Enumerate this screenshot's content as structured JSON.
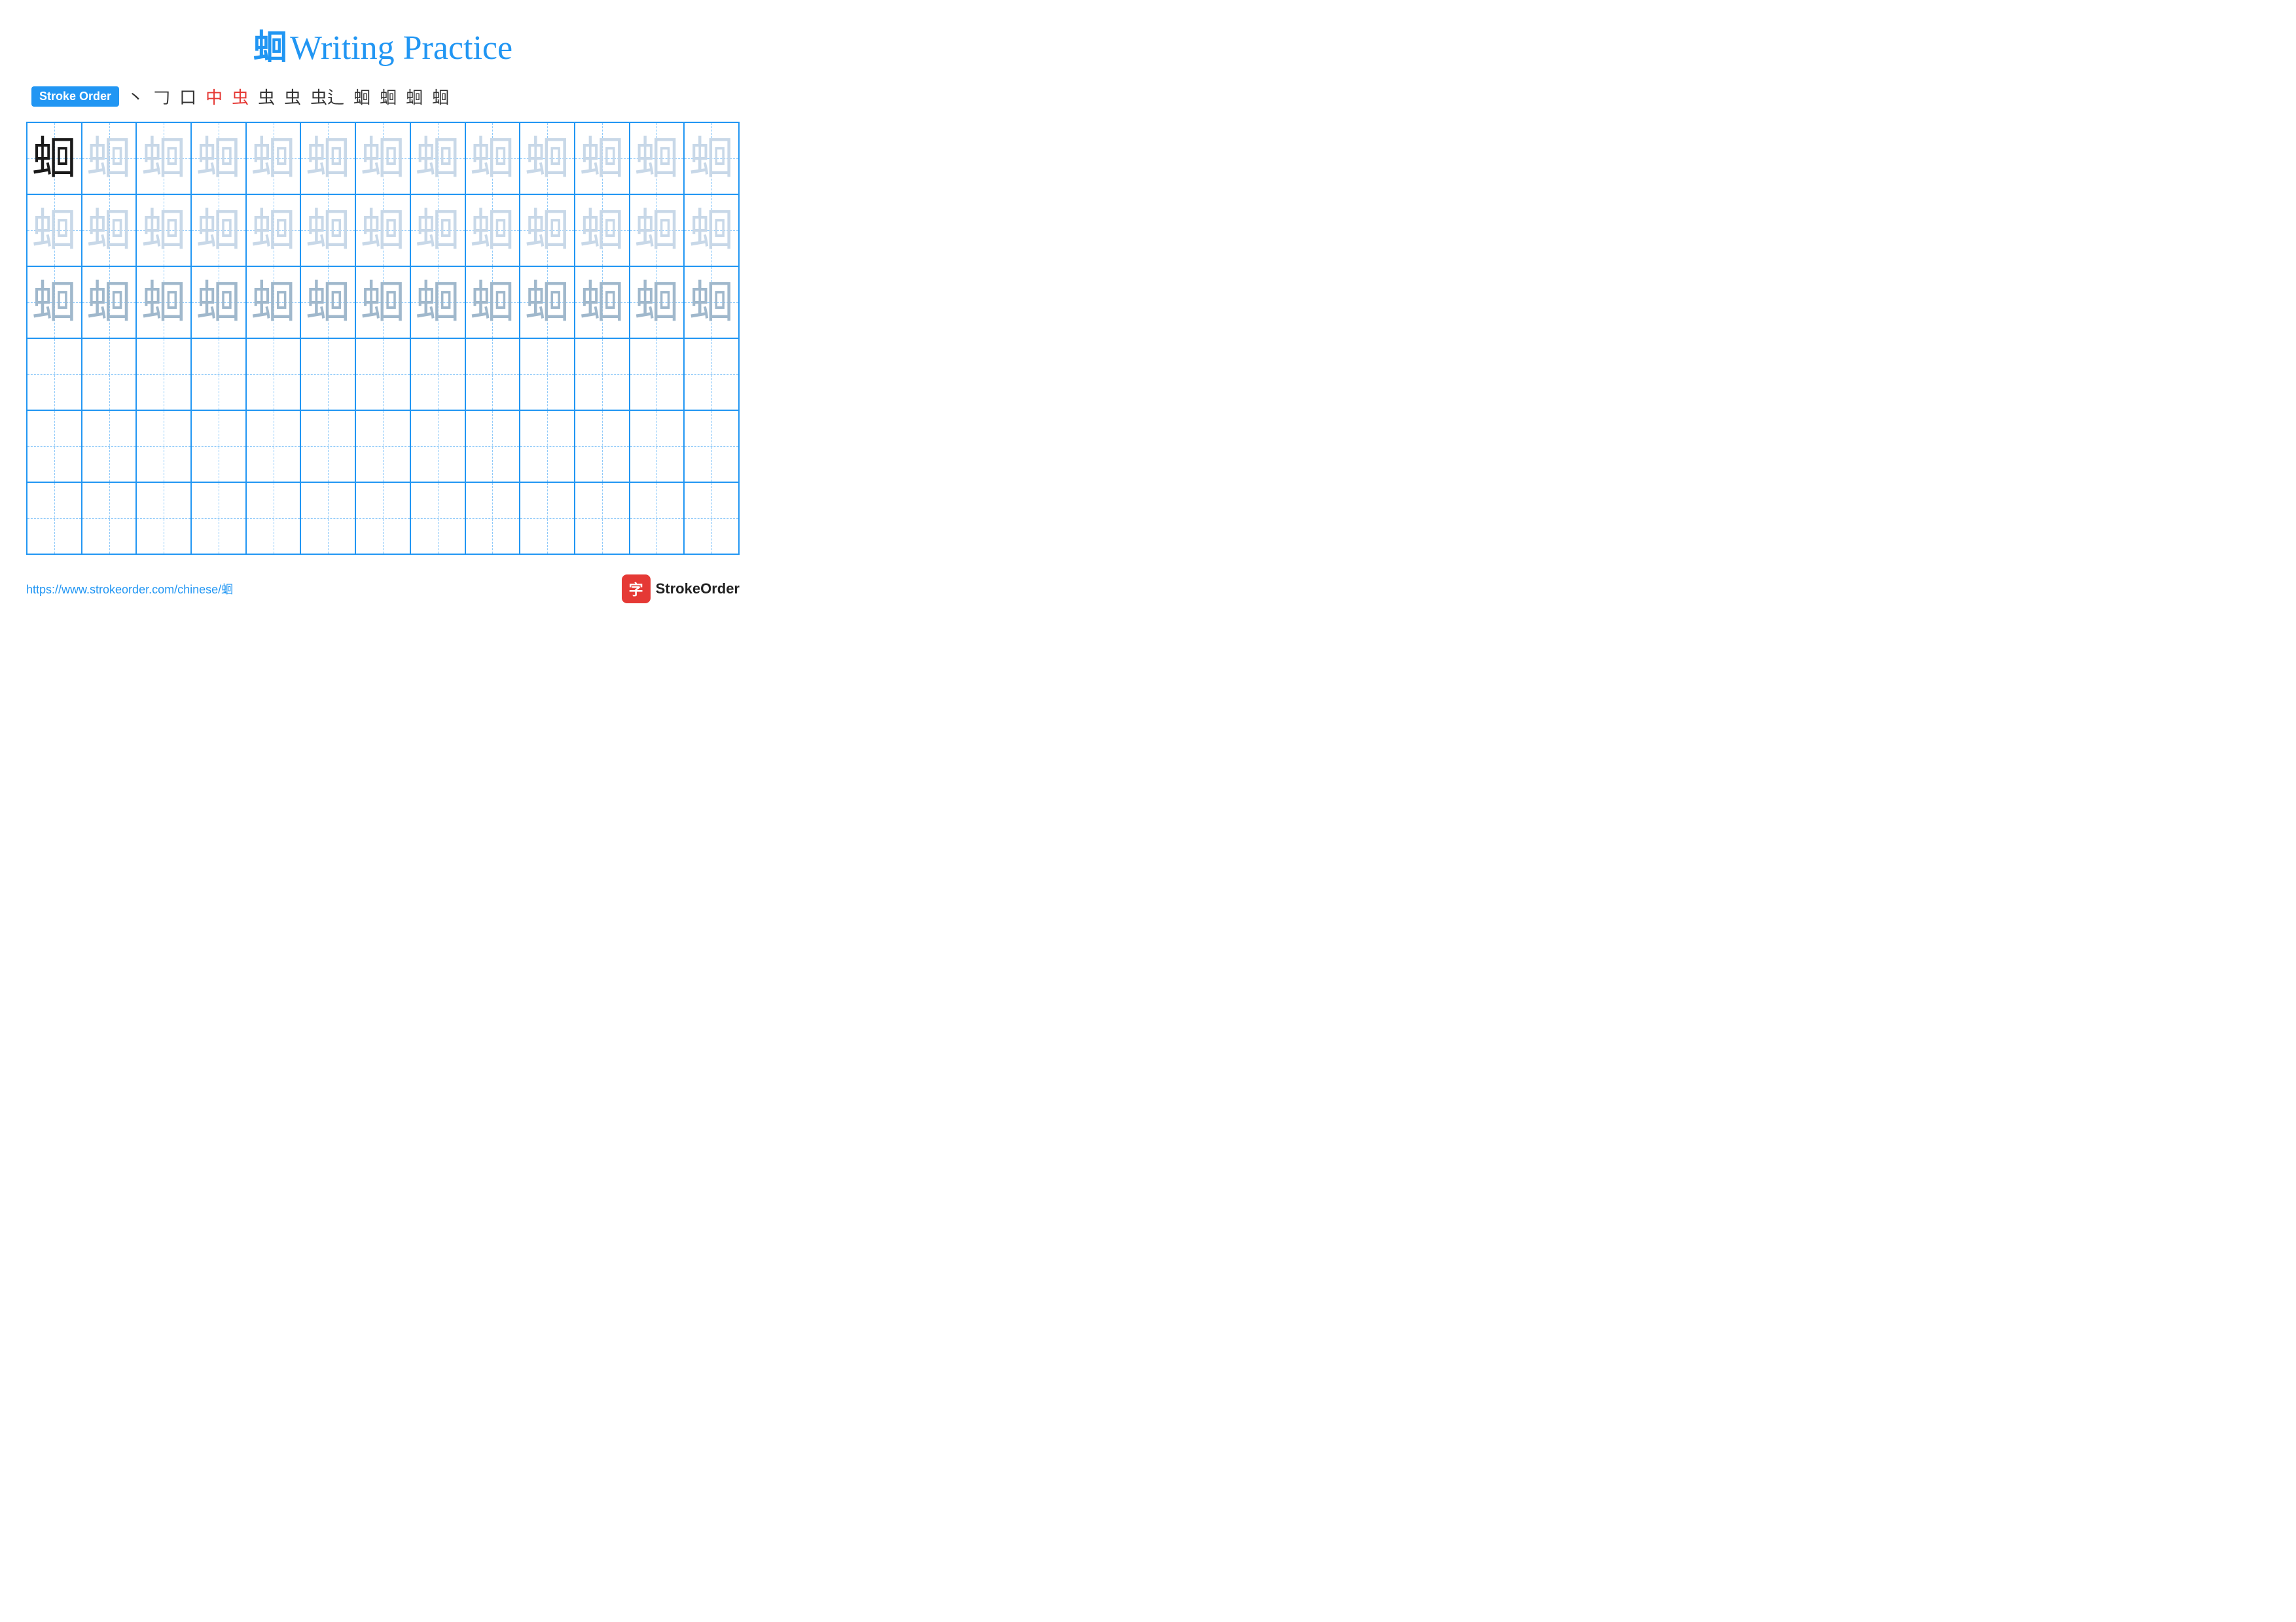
{
  "title": {
    "char": "蛔",
    "text": "Writing Practice"
  },
  "stroke_order": {
    "badge_label": "Stroke Order",
    "steps": [
      "丶",
      "口",
      "口",
      "中",
      "虫",
      "虫",
      "虫",
      "虫⻌",
      "蛔⁻",
      "蛔°",
      "蛔¹",
      "蛔"
    ]
  },
  "practice_char": "蛔",
  "rows": [
    {
      "type": "dark_then_light",
      "dark_count": 1,
      "light_count": 12
    },
    {
      "type": "all_light",
      "count": 13
    },
    {
      "type": "all_medium",
      "count": 13
    },
    {
      "type": "empty",
      "count": 13
    },
    {
      "type": "empty",
      "count": 13
    },
    {
      "type": "empty",
      "count": 13
    }
  ],
  "footer": {
    "link_text": "https://www.strokeorder.com/chinese/蛔",
    "logo_icon": "字",
    "logo_text": "StrokeOrder"
  }
}
